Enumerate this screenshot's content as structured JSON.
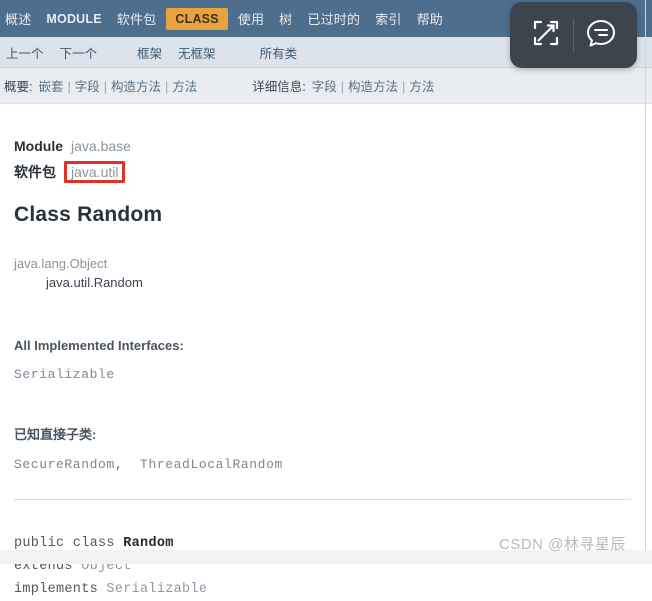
{
  "topnav": {
    "items": [
      {
        "label": "概述",
        "active": false,
        "latin": false
      },
      {
        "label": "MODULE",
        "active": false,
        "latin": true
      },
      {
        "label": "软件包",
        "active": false,
        "latin": false
      },
      {
        "label": "CLASS",
        "active": true,
        "latin": true
      },
      {
        "label": "使用",
        "active": false,
        "latin": false
      },
      {
        "label": "树",
        "active": false,
        "latin": false
      },
      {
        "label": "已过时的",
        "active": false,
        "latin": false
      },
      {
        "label": "索引",
        "active": false,
        "latin": false
      },
      {
        "label": "帮助",
        "active": false,
        "latin": false
      }
    ],
    "bg_color": "#4e6e8e",
    "active_color": "#e8a33d"
  },
  "subnav": {
    "prev": "上一个",
    "next": "下一个",
    "frames": "框架",
    "no_frames": "无框架",
    "all_classes": "所有类"
  },
  "summarybar": {
    "summary_label": "概要:",
    "summary_links": [
      "嵌套",
      "字段",
      "构造方法",
      "方法"
    ],
    "detail_label": "详细信息:",
    "detail_links": [
      "字段",
      "构造方法",
      "方法"
    ],
    "separator": "|"
  },
  "content": {
    "module_key": "Module",
    "module_value": "java.base",
    "package_key": "软件包",
    "package_value": "java.util",
    "package_highlight_color": "#e13322",
    "class_title": "Class Random",
    "inheritance": {
      "level1": "java.lang.Object",
      "level2": "java.util.Random"
    },
    "interfaces_heading": "All Implemented Interfaces:",
    "interfaces": [
      "Serializable"
    ],
    "subclasses_heading": "已知直接子类:",
    "subclasses": [
      "SecureRandom",
      "ThreadLocalRandom"
    ],
    "declaration": {
      "line1_kw": "public class",
      "line1_name": "Random",
      "line2_kw": "extends",
      "line2_type": "Object",
      "line3_kw": "implements",
      "line3_type": "Serializable"
    }
  },
  "floatpanel": {
    "expand_title": "展开",
    "comment_title": "评论"
  },
  "watermark": {
    "text": "CSDN @林寻星辰"
  }
}
